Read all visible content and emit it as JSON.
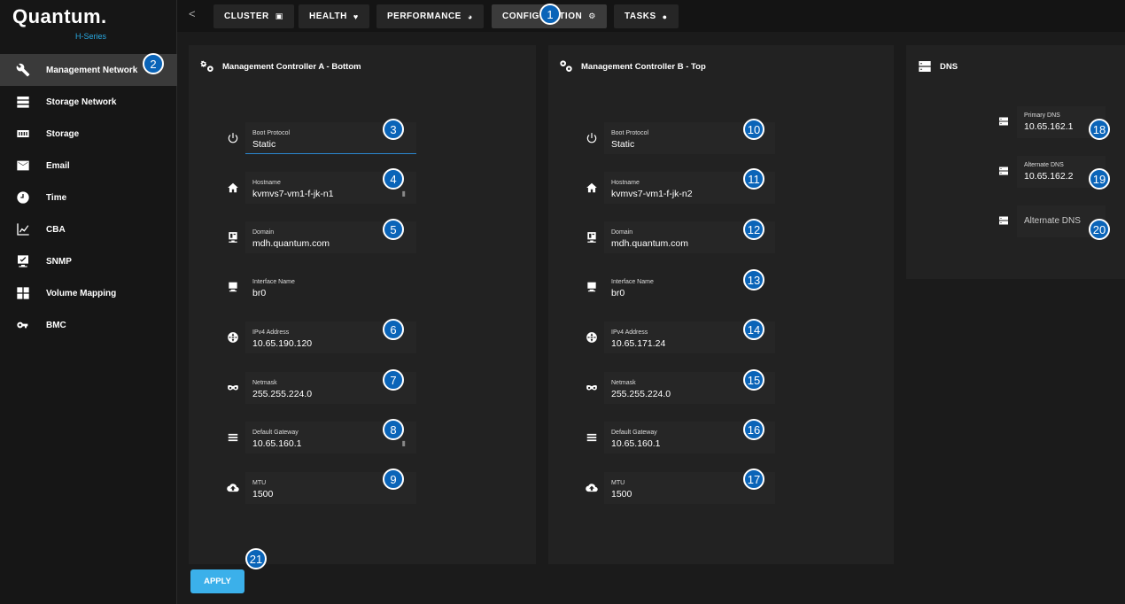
{
  "brand": {
    "name": "Quantum.",
    "series": "H-Series"
  },
  "sidebar": {
    "items": [
      {
        "label": "Management Network",
        "icon": "wrench-icon",
        "active": true
      },
      {
        "label": "Storage Network",
        "icon": "server-icon"
      },
      {
        "label": "Storage",
        "icon": "storage-icon"
      },
      {
        "label": "Email",
        "icon": "email-icon"
      },
      {
        "label": "Time",
        "icon": "clock-icon"
      },
      {
        "label": "CBA",
        "icon": "chart-icon"
      },
      {
        "label": "SNMP",
        "icon": "snmp-icon"
      },
      {
        "label": "Volume Mapping",
        "icon": "grid-icon"
      },
      {
        "label": "BMC",
        "icon": "key-icon"
      }
    ]
  },
  "topbar": {
    "back": "<",
    "tabs": [
      {
        "label": "CLUSTER",
        "icon": "cluster-icon"
      },
      {
        "label": "HEALTH",
        "icon": "heart-icon"
      },
      {
        "label": "PERFORMANCE",
        "icon": "gauge-icon"
      },
      {
        "label": "CONFIGURATION",
        "icon": "gears-icon",
        "active": true
      },
      {
        "label": "TASKS",
        "icon": "person-icon"
      }
    ]
  },
  "controller_a": {
    "title": "Management Controller A - Bottom",
    "fields": [
      {
        "label": "Boot Protocol",
        "value": "Static"
      },
      {
        "label": "Hostname",
        "value": "kvmvs7-vm1-f-jk-n1"
      },
      {
        "label": "Domain",
        "value": "mdh.quantum.com"
      },
      {
        "label": "Interface Name",
        "value": "br0"
      },
      {
        "label": "IPv4 Address",
        "value": "10.65.190.120"
      },
      {
        "label": "Netmask",
        "value": "255.255.224.0"
      },
      {
        "label": "Default Gateway",
        "value": "10.65.160.1"
      },
      {
        "label": "MTU",
        "value": "1500"
      }
    ]
  },
  "controller_b": {
    "title": "Management Controller B - Top",
    "fields": [
      {
        "label": "Boot Protocol",
        "value": "Static"
      },
      {
        "label": "Hostname",
        "value": "kvmvs7-vm1-f-jk-n2"
      },
      {
        "label": "Domain",
        "value": "mdh.quantum.com"
      },
      {
        "label": "Interface Name",
        "value": "br0"
      },
      {
        "label": "IPv4 Address",
        "value": "10.65.171.24"
      },
      {
        "label": "Netmask",
        "value": "255.255.224.0"
      },
      {
        "label": "Default Gateway",
        "value": "10.65.160.1"
      },
      {
        "label": "MTU",
        "value": "1500"
      }
    ]
  },
  "dns": {
    "title": "DNS",
    "primary": {
      "label": "Primary DNS",
      "value": "10.65.162.1"
    },
    "alternate": {
      "label": "Alternate DNS",
      "value": "10.65.162.2"
    },
    "alternate2": {
      "placeholder": "Alternate DNS"
    }
  },
  "apply_label": "APPLY",
  "badges": [
    "1",
    "2",
    "3",
    "4",
    "5",
    "6",
    "7",
    "8",
    "9",
    "10",
    "11",
    "12",
    "13",
    "14",
    "15",
    "16",
    "17",
    "18",
    "19",
    "20",
    "21"
  ],
  "colors": {
    "accent": "#3bb0ea",
    "badge": "#0a64b8",
    "brand_sub": "#29a8e0"
  }
}
